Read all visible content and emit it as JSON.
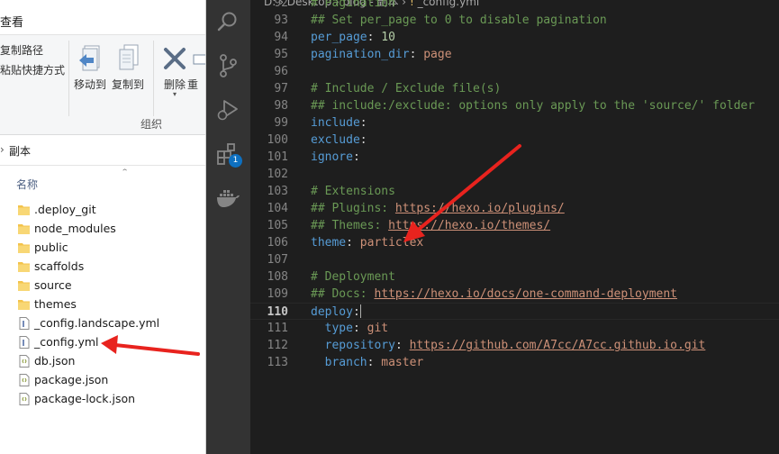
{
  "explorer": {
    "ribbon_tab": "查看",
    "ribbon": {
      "copy_path": "复制路径",
      "paste_shortcut": "粘贴快捷方式",
      "move_to": "移动到",
      "copy_to": "复制到",
      "delete": "删除",
      "rename_partial": "重",
      "group_label": "组织"
    },
    "address": {
      "separator": "›",
      "text": "副本"
    },
    "column_name": "名称",
    "files": [
      {
        "name": ".deploy_git",
        "type": "folder"
      },
      {
        "name": "node_modules",
        "type": "folder"
      },
      {
        "name": "public",
        "type": "folder"
      },
      {
        "name": "scaffolds",
        "type": "folder"
      },
      {
        "name": "source",
        "type": "folder"
      },
      {
        "name": "themes",
        "type": "folder"
      },
      {
        "name": "_config.landscape.yml",
        "type": "yml-file"
      },
      {
        "name": "_config.yml",
        "type": "yml-file"
      },
      {
        "name": "db.json",
        "type": "json-file"
      },
      {
        "name": "package.json",
        "type": "json-file"
      },
      {
        "name": "package-lock.json",
        "type": "json-file"
      }
    ]
  },
  "vscode": {
    "breadcrumb": {
      "path": "D: › Desktop › blog - 副本 › ",
      "icon": "!",
      "file": " _config.yml"
    },
    "extensions_badge": "1",
    "activity_icons": [
      "search-icon",
      "source-control-icon",
      "run-debug-icon",
      "extensions-icon",
      "docker-icon"
    ],
    "current_line": "110",
    "lines": [
      {
        "num": "92",
        "tokens": [
          [
            "c",
            "# Pagination"
          ]
        ]
      },
      {
        "num": "93",
        "tokens": [
          [
            "c",
            "## Set per_page to 0 to disable pagination"
          ]
        ]
      },
      {
        "num": "94",
        "tokens": [
          [
            "k",
            "per_page"
          ],
          [
            "p",
            ": "
          ],
          [
            "n",
            "10"
          ]
        ]
      },
      {
        "num": "95",
        "tokens": [
          [
            "k",
            "pagination_dir"
          ],
          [
            "p",
            ": "
          ],
          [
            "v",
            "page"
          ]
        ]
      },
      {
        "num": "96",
        "tokens": []
      },
      {
        "num": "97",
        "tokens": [
          [
            "c",
            "# Include / Exclude file(s)"
          ]
        ]
      },
      {
        "num": "98",
        "tokens": [
          [
            "c",
            "## include:/exclude: options only apply to the 'source/' folder"
          ]
        ]
      },
      {
        "num": "99",
        "tokens": [
          [
            "k",
            "include"
          ],
          [
            "p",
            ":"
          ]
        ]
      },
      {
        "num": "100",
        "tokens": [
          [
            "k",
            "exclude"
          ],
          [
            "p",
            ":"
          ]
        ]
      },
      {
        "num": "101",
        "tokens": [
          [
            "k",
            "ignore"
          ],
          [
            "p",
            ":"
          ]
        ]
      },
      {
        "num": "102",
        "tokens": []
      },
      {
        "num": "103",
        "tokens": [
          [
            "c",
            "# Extensions"
          ]
        ]
      },
      {
        "num": "104",
        "tokens": [
          [
            "c",
            "## Plugins: "
          ],
          [
            "u",
            "https://hexo.io/plugins/"
          ]
        ]
      },
      {
        "num": "105",
        "tokens": [
          [
            "c",
            "## Themes: "
          ],
          [
            "u",
            "https://hexo.io/themes/"
          ]
        ]
      },
      {
        "num": "106",
        "tokens": [
          [
            "k",
            "theme"
          ],
          [
            "p",
            ": "
          ],
          [
            "v",
            "particlex"
          ]
        ]
      },
      {
        "num": "107",
        "tokens": []
      },
      {
        "num": "108",
        "tokens": [
          [
            "c",
            "# Deployment"
          ]
        ]
      },
      {
        "num": "109",
        "tokens": [
          [
            "c",
            "## Docs: "
          ],
          [
            "u",
            "https://hexo.io/docs/one-command-deployment"
          ]
        ]
      },
      {
        "num": "110",
        "tokens": [
          [
            "k",
            "deploy"
          ],
          [
            "p",
            ":"
          ],
          [
            "cursor",
            ""
          ]
        ]
      },
      {
        "num": "111",
        "tokens": [
          [
            "i",
            "  "
          ],
          [
            "k",
            "type"
          ],
          [
            "p",
            ": "
          ],
          [
            "v",
            "git"
          ]
        ]
      },
      {
        "num": "112",
        "tokens": [
          [
            "i",
            "  "
          ],
          [
            "k",
            "repository"
          ],
          [
            "p",
            ": "
          ],
          [
            "u",
            "https://github.com/A7cc/A7cc.github.io.git"
          ]
        ]
      },
      {
        "num": "113",
        "tokens": [
          [
            "i",
            "  "
          ],
          [
            "k",
            "branch"
          ],
          [
            "p",
            ": "
          ],
          [
            "v",
            "master"
          ]
        ]
      }
    ]
  },
  "colors": {
    "annotation_arrow": "#e8231e",
    "folder": "#f3c34b",
    "editor_bg": "#1e1e1e",
    "activity_bar": "#333333",
    "badge": "#0e70c0"
  }
}
